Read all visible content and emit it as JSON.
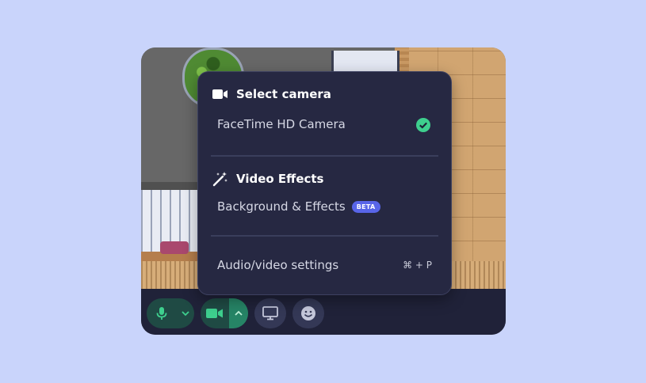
{
  "menu": {
    "camera_section": {
      "title": "Select camera",
      "icon": "video-camera-icon",
      "selected_device": "FaceTime HD Camera"
    },
    "effects_section": {
      "title": "Video Effects",
      "icon": "magic-wand-icon",
      "item_label": "Background & Effects",
      "badge": "BETA"
    },
    "settings": {
      "label": "Audio/video settings",
      "shortcut": "⌘ + P"
    }
  },
  "toolbar": {
    "mic_icon": "microphone-icon",
    "camera_icon": "video-camera-icon",
    "screen_icon": "monitor-icon",
    "emoji_icon": "smiley-icon"
  },
  "colors": {
    "background": "#c9d4fb",
    "menu_bg": "#262842",
    "accent_green": "#3ecf8e",
    "beta_badge": "#5865e8"
  }
}
